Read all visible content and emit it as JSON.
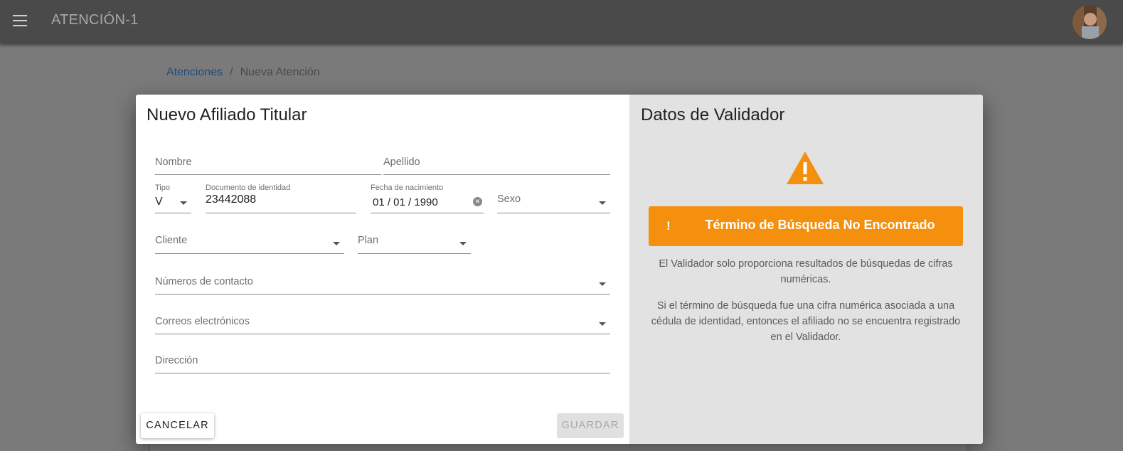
{
  "appbar": {
    "title": "ATENCIÓN-1"
  },
  "breadcrumb": {
    "link": "Atenciones",
    "separator": "/",
    "current": "Nueva Atención"
  },
  "dialog": {
    "left": {
      "title": "Nuevo Afiliado Titular",
      "fields": {
        "nombre": {
          "label": "Nombre",
          "value": ""
        },
        "apellido": {
          "label": "Apellido",
          "value": ""
        },
        "tipo": {
          "label": "Tipo",
          "value": "V"
        },
        "documento": {
          "label": "Documento de identidad",
          "value": "23442088"
        },
        "fecha": {
          "label": "Fecha de nacimiento",
          "value": "01 / 01 / 1990"
        },
        "sexo": {
          "label": "Sexo",
          "value": ""
        },
        "cliente": {
          "label": "Cliente",
          "value": ""
        },
        "plan": {
          "label": "Plan",
          "value": ""
        },
        "contacto": {
          "label": "Números de contacto",
          "value": ""
        },
        "correos": {
          "label": "Correos electrónicos",
          "value": ""
        },
        "direccion": {
          "label": "Dirección",
          "value": ""
        }
      },
      "buttons": {
        "cancel": "CANCELAR",
        "save": "GUARDAR"
      }
    },
    "right": {
      "title": "Datos de Validador",
      "alert": {
        "mark": "!",
        "text": "Término de Búsqueda No Encontrado"
      },
      "info1": "El Validador solo proporciona resultados de búsquedas de cifras numéricas.",
      "info2": "Si el término de búsqueda fue una cifra numérica asociada a una cédula de identidad, entonces el afiliado no se encuentra registrado en el Validador."
    }
  },
  "colors": {
    "accent": "#f5900f",
    "link": "#1e4d7a",
    "appbar": "#4a4a4a"
  },
  "icons": {
    "menu": "menu-icon",
    "warning": "warning-icon",
    "clear": "clear-icon",
    "dropdown": "chevron-down-icon"
  }
}
